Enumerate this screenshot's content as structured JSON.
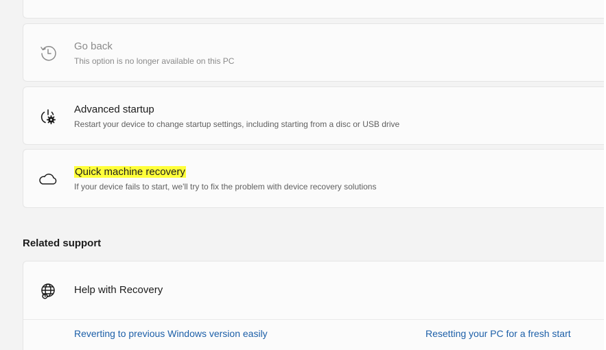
{
  "recovery_options": {
    "go_back": {
      "title": "Go back",
      "description": "This option is no longer available on this PC",
      "icon": "history-icon"
    },
    "advanced_startup": {
      "title": "Advanced startup",
      "description": "Restart your device to change startup settings, including starting from a disc or USB drive",
      "icon": "power-gear-icon"
    },
    "quick_machine_recovery": {
      "title": "Quick machine recovery",
      "description": "If your device fails to start, we'll try to fix the problem with device recovery solutions",
      "icon": "cloud-icon",
      "highlight_color": "#ffff3a"
    }
  },
  "related_support": {
    "heading": "Related support",
    "help": {
      "title": "Help with Recovery",
      "icon": "globe-help-icon"
    },
    "links": [
      "Reverting to previous Windows version easily",
      "Resetting your PC for a fresh start"
    ]
  },
  "colors": {
    "link": "#1c5fa8",
    "card_bg": "#fbfbfb",
    "page_bg": "#f3f3f3"
  }
}
